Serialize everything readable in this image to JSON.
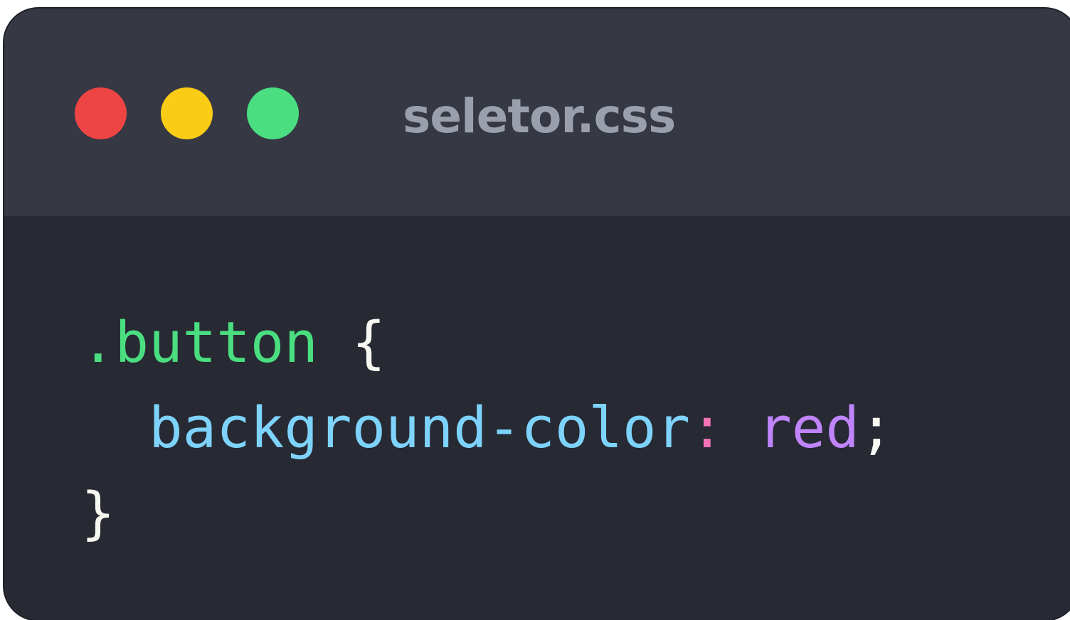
{
  "window": {
    "filename": "seletor.css",
    "controls": [
      {
        "name": "close",
        "color": "#ef4444"
      },
      {
        "name": "minimize",
        "color": "#facc15"
      },
      {
        "name": "maximize",
        "color": "#4ade80"
      }
    ]
  },
  "code": {
    "lines": [
      [
        {
          "text": ".button",
          "color": "#4ade80"
        },
        {
          "text": " ",
          "color": "#f8f8f2"
        },
        {
          "text": "{",
          "color": "#f8f8f2"
        }
      ],
      [
        {
          "text": "  ",
          "color": "#f8f8f2"
        },
        {
          "text": "background-color",
          "color": "#7dd3fc"
        },
        {
          "text": ":",
          "color": "#f472b6"
        },
        {
          "text": " ",
          "color": "#f8f8f2"
        },
        {
          "text": "red",
          "color": "#c084fc"
        },
        {
          "text": ";",
          "color": "#f8f8f2"
        }
      ],
      [
        {
          "text": "}",
          "color": "#f8f8f2"
        }
      ]
    ]
  },
  "colors": {
    "titlebar_bg": "#363844",
    "editor_bg": "#272933",
    "filename_text": "#9aa0ab"
  }
}
